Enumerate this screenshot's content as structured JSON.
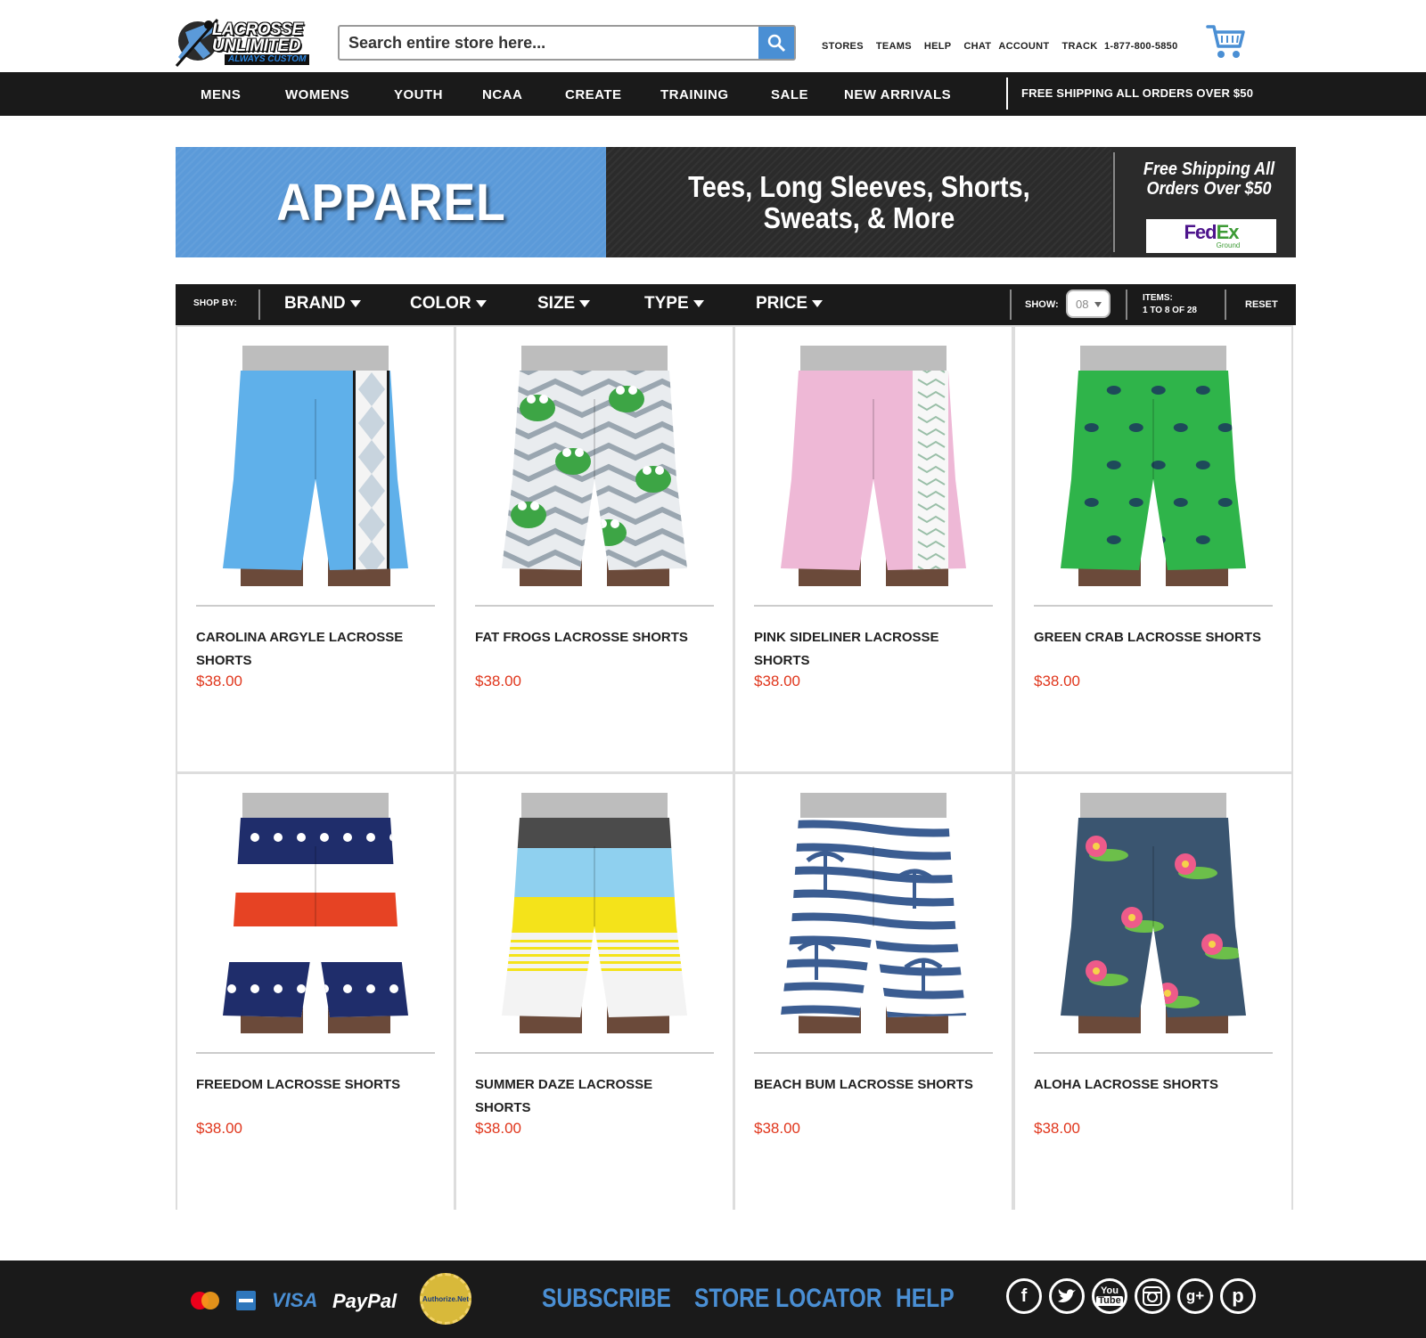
{
  "header": {
    "logo_line1": "LACROSSE",
    "logo_line2": "UNLIMITED",
    "logo_tagline": "ALWAYS CUSTOM",
    "search_placeholder": "Search entire store here...",
    "links": [
      "STORES",
      "TEAMS",
      "HELP",
      "CHAT",
      "ACCOUNT",
      "TRACK"
    ],
    "phone": "1-877-800-5850"
  },
  "nav": {
    "items": [
      "MENS",
      "WOMENS",
      "YOUTH",
      "NCAA",
      "CREATE",
      "TRAINING",
      "SALE",
      "NEW ARRIVALS"
    ],
    "shipping": "FREE SHIPPING ALL ORDERS OVER $50"
  },
  "banner": {
    "title": "APPAREL",
    "line1": "Tees, Long Sleeves, Shorts,",
    "line2": "Sweats, & More",
    "ship1": "Free Shipping All",
    "ship2": "Orders Over $50",
    "fedex_fe": "Fed",
    "fedex_ex": "Ex",
    "fedex_ground": "Ground"
  },
  "filters": {
    "shop_by": "SHOP BY:",
    "items": [
      "BRAND",
      "COLOR",
      "SIZE",
      "TYPE",
      "PRICE"
    ],
    "show_label": "SHOW:",
    "show_value": "08",
    "items_label": "ITEMS:",
    "items_range": "1 TO 8 OF 28",
    "reset": "RESET"
  },
  "products": [
    {
      "name": "CAROLINA ARGYLE LACROSSE SHORTS",
      "price": "$38.00",
      "pattern": "argyle",
      "color": "#5fb0ea"
    },
    {
      "name": "FAT FROGS LACROSSE SHORTS",
      "price": "$38.00",
      "pattern": "frogs",
      "color": "#e9ecef"
    },
    {
      "name": "PINK SIDELINER LACROSSE SHORTS",
      "price": "$38.00",
      "pattern": "sideliner",
      "color": "#eeb8d6"
    },
    {
      "name": "GREEN CRAB LACROSSE SHORTS",
      "price": "$38.00",
      "pattern": "crab",
      "color": "#2fb44a"
    },
    {
      "name": "FREEDOM LACROSSE SHORTS",
      "price": "$38.00",
      "pattern": "freedom",
      "color": "#ffffff"
    },
    {
      "name": "SUMMER DAZE LACROSSE SHORTS",
      "price": "$38.00",
      "pattern": "summer",
      "color": "#f3f3f3"
    },
    {
      "name": "BEACH BUM LACROSSE SHORTS",
      "price": "$38.00",
      "pattern": "beach",
      "color": "#ffffff"
    },
    {
      "name": "ALOHA LACROSSE SHORTS",
      "price": "$38.00",
      "pattern": "aloha",
      "color": "#3a5570"
    }
  ],
  "footer": {
    "payments": [
      "MasterCard",
      "AMEX",
      "VISA",
      "PayPal",
      "Authorize.Net"
    ],
    "links": [
      "SUBSCRIBE",
      "STORE LOCATOR",
      "HELP"
    ],
    "social": [
      "facebook-icon",
      "twitter-icon",
      "youtube-icon",
      "instagram-icon",
      "google-plus-icon",
      "pinterest-icon"
    ]
  },
  "colors": {
    "accent_blue": "#4a8fd4",
    "price_red": "#e0361c",
    "dark_bar": "#1a1a1a"
  }
}
